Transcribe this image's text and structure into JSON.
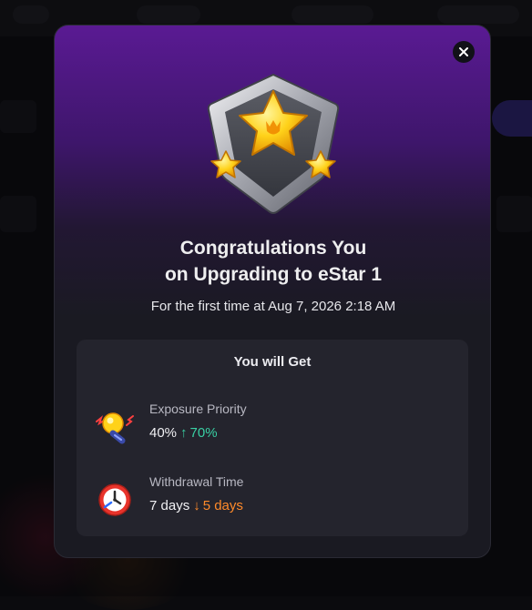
{
  "modal": {
    "close_icon": "close-icon",
    "badge_icon": "star-badge-icon",
    "title_line1": "Congratulations You",
    "title_line2": "on Upgrading to eStar 1",
    "subtitle": "For the first time at Aug 7, 2026 2:18 AM",
    "benefits": {
      "heading": "You will Get",
      "items": [
        {
          "icon": "lightbulb-icon",
          "label": "Exposure Priority",
          "old_value": "40%",
          "direction": "up",
          "arrow": "↑",
          "new_value": "70%"
        },
        {
          "icon": "clock-icon",
          "label": "Withdrawal Time",
          "old_value": "7 days",
          "direction": "down",
          "arrow": "↓",
          "new_value": "5 days"
        }
      ]
    }
  },
  "colors": {
    "accent_purple": "#5a1a93",
    "increase_green": "#39d0a4",
    "decrease_orange": "#ff8a2a",
    "panel_bg": "#24242d"
  }
}
